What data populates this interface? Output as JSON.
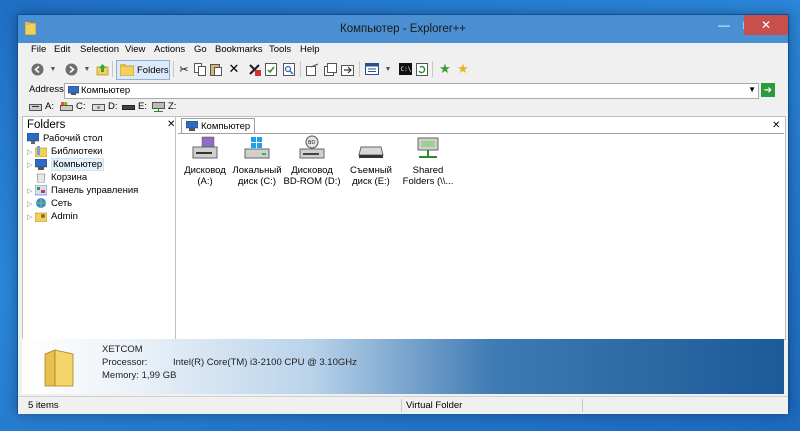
{
  "window": {
    "title": "Компьютер - Explorer++",
    "minimize_glyph": "—",
    "maximize_glyph": "□",
    "close_glyph": "✕"
  },
  "menu": [
    "File",
    "Edit",
    "Selection",
    "View",
    "Actions",
    "Go",
    "Bookmarks",
    "Tools",
    "Help"
  ],
  "toolbar": {
    "folders_label": "Folders",
    "icons": [
      "back-icon",
      "forward-icon",
      "up-icon",
      "cut-icon",
      "copy-icon",
      "paste-icon",
      "delete-icon",
      "delete-permanently-icon",
      "properties-icon",
      "search-icon",
      "move-to-icon",
      "copy-to-icon",
      "new-folder-icon",
      "views-icon",
      "command-prompt-icon",
      "refresh-icon",
      "add-bookmark-icon",
      "organize-bookmarks-icon"
    ]
  },
  "address": {
    "label": "Address",
    "value": "Компьютер",
    "go_glyph": "➜"
  },
  "drives": [
    "A:",
    "C:",
    "D:",
    "E:",
    "Z:"
  ],
  "folders_pane": {
    "title": "Folders",
    "close_glyph": "✕",
    "items": [
      {
        "label": "Рабочий стол",
        "icon": "desktop-icon"
      },
      {
        "label": "Библиотеки",
        "icon": "libraries-icon"
      },
      {
        "label": "Компьютер",
        "icon": "computer-icon"
      },
      {
        "label": "Корзина",
        "icon": "recycle-bin-icon"
      },
      {
        "label": "Панель управления",
        "icon": "control-panel-icon"
      },
      {
        "label": "Сеть",
        "icon": "network-icon"
      },
      {
        "label": "Admin",
        "icon": "user-folder-icon"
      }
    ]
  },
  "tab": {
    "label": "Компьютер",
    "close_glyph": "✕"
  },
  "files": [
    {
      "line1": "Дисковод",
      "line2": "(A:)",
      "icon": "floppy-drive-icon"
    },
    {
      "line1": "Локальный",
      "line2": "диск (C:)",
      "icon": "local-disk-icon"
    },
    {
      "line1": "Дисковод",
      "line2": "BD-ROM (D:)",
      "icon": "bd-rom-drive-icon"
    },
    {
      "line1": "Съемный",
      "line2": "диск (E:)",
      "icon": "removable-disk-icon"
    },
    {
      "line1": "Shared",
      "line2": "Folders (\\\\...",
      "icon": "network-share-icon"
    }
  ],
  "info": {
    "name": "XETCOM",
    "processor_label": "Processor:",
    "processor_value": "Intel(R) Core(TM) i3-2100 CPU @ 3.10GHz",
    "memory": "Memory: 1,99 GB"
  },
  "status": {
    "items": "5 items",
    "type": "Virtual Folder"
  }
}
